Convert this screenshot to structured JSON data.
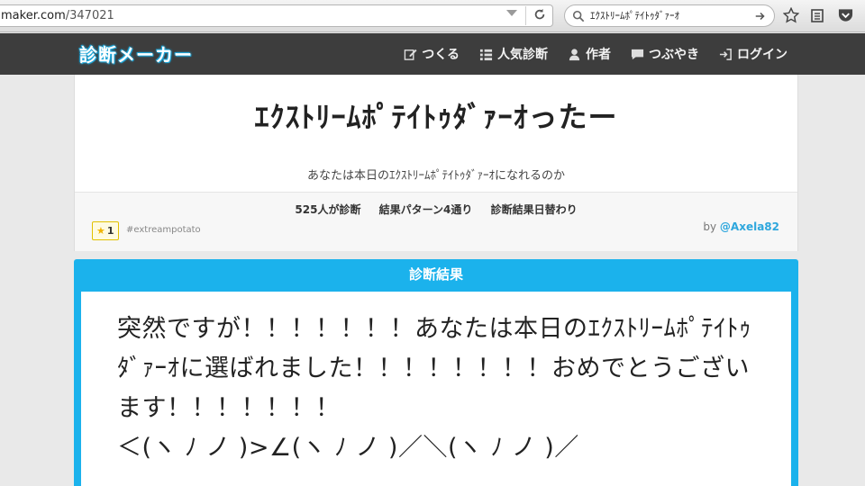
{
  "browser": {
    "url_host": "maker.com",
    "url_path": "/347021",
    "search_query": "ｴｸｽﾄﾘｰﾑﾎﾟﾃｲﾄｩﾀﾞｧｰｵ"
  },
  "site": {
    "logo": "診断メーカー",
    "nav": [
      {
        "label": "つくる",
        "icon": "edit-icon"
      },
      {
        "label": "人気診断",
        "icon": "list-icon"
      },
      {
        "label": "作者",
        "icon": "user-icon"
      },
      {
        "label": "つぶやき",
        "icon": "chat-icon"
      },
      {
        "label": "ログイン",
        "icon": "login-icon"
      }
    ]
  },
  "card": {
    "title": "ｴｸｽﾄﾘｰﾑﾎﾟﾃｲﾄｩﾀﾞｧｰｵったー",
    "subtitle": "あなたは本日のｴｸｽﾄﾘｰﾑﾎﾟﾃｲﾄｩﾀﾞｧｰｵになれるのか",
    "stats": {
      "users": "525人が診断",
      "patterns": "結果パターン4通り",
      "daily": "診断結果日替わり"
    },
    "fav_count": "1",
    "hashtag": "#extreampotato",
    "author_prefix": "by",
    "author": "@Axela82"
  },
  "result": {
    "heading": "診断結果",
    "text": "突然ですが！！！！！！！あなたは本日のｴｸｽﾄﾘｰﾑﾎﾟﾃｲﾄｩﾀﾞｧｰｵに選ばれました！！！！！！！！おめでとうございます！！！！！！！\n＜(ヽ ﾉ ノ )>∠(ヽ ﾉ ノ )／＼(ヽ ﾉ ノ )／"
  },
  "colors": {
    "accent": "#1bb2ec",
    "header_bg": "#3d3d3d",
    "link": "#2ea7dd"
  }
}
